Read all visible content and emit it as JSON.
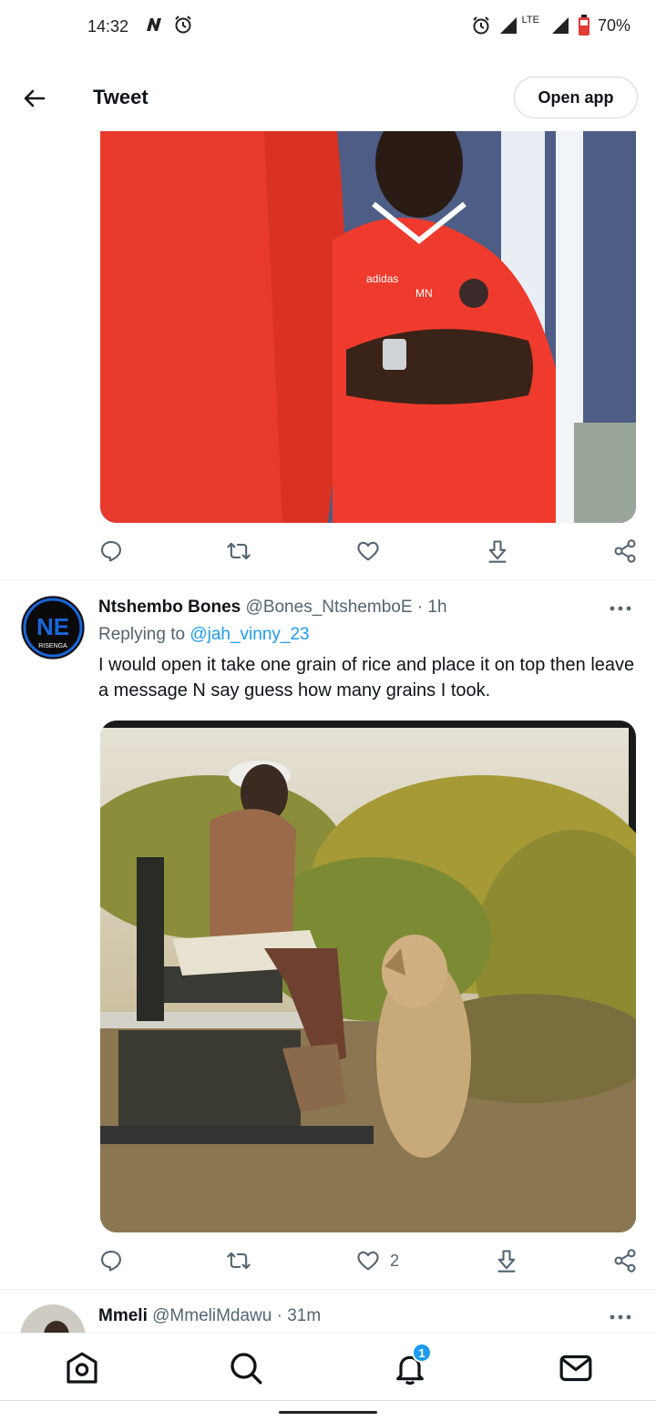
{
  "status_bar": {
    "time": "14:32",
    "network": "LTE",
    "battery": "70%",
    "icons": [
      "n-notification-icon",
      "alarm-icon",
      "signal-icon",
      "battery-icon"
    ]
  },
  "header": {
    "title": "Tweet",
    "open_app_label": "Open app"
  },
  "tweets": [
    {
      "image_alt": "Coach in red jersey with arms crossed",
      "actions": {
        "reply": "",
        "retweet": "",
        "like": "",
        "download": "",
        "share": ""
      }
    },
    {
      "name": "Ntshembo Bones",
      "handle": "@Bones_NtshemboE",
      "time": "1h",
      "replying_prefix": "Replying to",
      "replying_to": "@jah_vinny_23",
      "text": "I would open it take one grain of rice and place it on top then leave a message N say guess how many grains I took.",
      "avatar_text": "NE",
      "avatar_subtext": "RISENGA",
      "actions": {
        "reply": "",
        "retweet": "",
        "like": "2",
        "download": "",
        "share": ""
      }
    },
    {
      "name": "Mmeli",
      "handle": "@MmeliMdawu",
      "time": "31m"
    }
  ],
  "bottom_nav": {
    "notification_badge": "1",
    "items": [
      "home-icon",
      "search-icon",
      "notifications-icon",
      "messages-icon"
    ]
  },
  "colors": {
    "accent": "#1d9bf0",
    "text_primary": "#0f1419",
    "text_secondary": "#536471",
    "divider": "#eff3f4"
  }
}
